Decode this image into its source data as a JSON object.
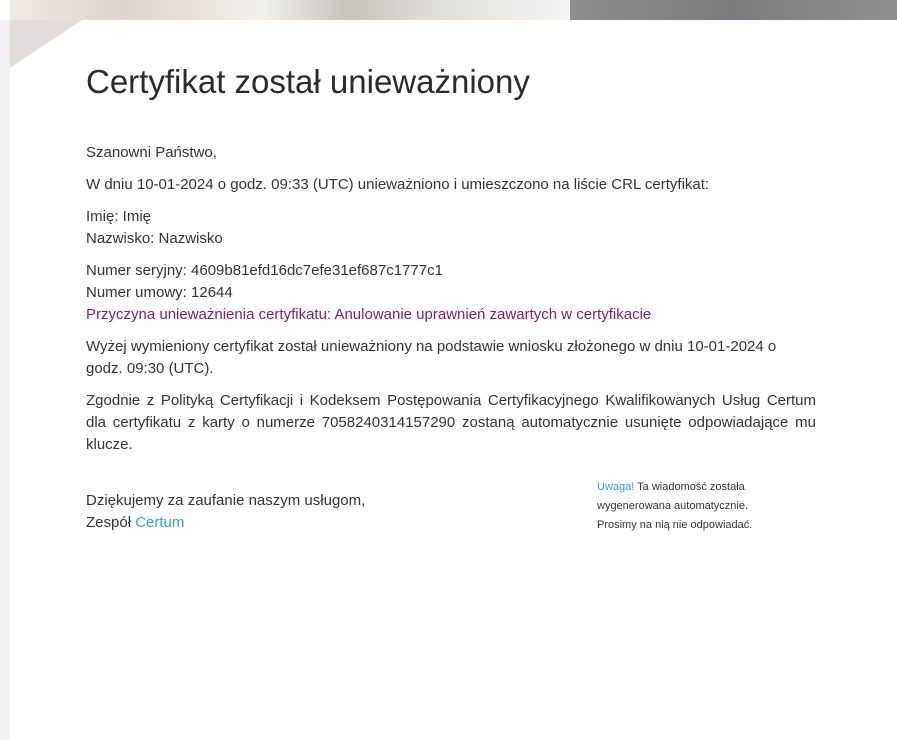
{
  "title": "Certyfikat został unieważniony",
  "greeting": "Szanowni Państwo,",
  "intro": "W dniu 10-01-2024 o godz. 09:33 (UTC) unieważniono i umieszczono na liście CRL certyfikat:",
  "details": {
    "first_name": "Imię: Imię",
    "last_name": "Nazwisko: Nazwisko",
    "serial": "Numer seryjny: 4609b81efd16dc7efe31ef687c1777c1",
    "contract": "Numer umowy: 12644",
    "reason": "Przyczyna unieważnienia certyfikatu: Anulowanie uprawnień zawartych w certyfikacie"
  },
  "request_info": "Wyżej wymieniony certyfikat został unieważniony na podstawie wniosku złożonego w dniu 10-01-2024 o godz. 09:30 (UTC).",
  "policy_info": "Zgodnie z Polityką Certyfikacji i Kodeksem Postępowania Certyfikacyjnego Kwalifikowanych Usług Certum dla certyfikatu z karty o numerze 7058240314157290 zostaną automatycznie usunięte odpowiadające mu klucze.",
  "footer": {
    "thanks": "Dziękujemy za zaufanie naszym usługom,",
    "team_prefix": "Zespół",
    "team_name": "Certum",
    "note_label": "Uwaga!",
    "note_line1": "Ta wiadomość została",
    "note_line2": "wygenerowana automatycznie.",
    "note_line3": "Prosimy na nią nie odpowiadać."
  },
  "colors": {
    "accent": "#2aa3d8",
    "reason": "#8a1b6e",
    "text": "#333333"
  }
}
